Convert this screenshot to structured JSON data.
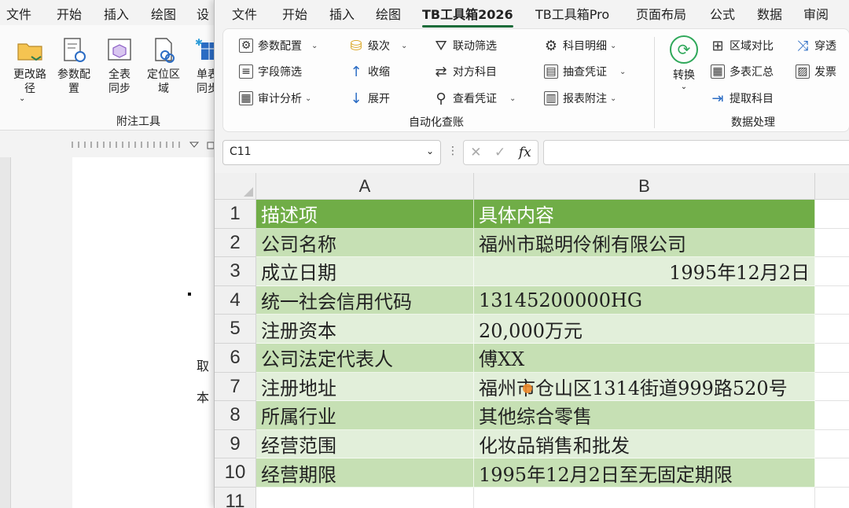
{
  "word": {
    "menu": [
      "文件",
      "开始",
      "插入",
      "绘图",
      "设"
    ],
    "ribbon_buttons": [
      {
        "label": "更改路\n径",
        "caret": "⌄"
      },
      {
        "label": "参数配\n置",
        "caret": "⌄"
      },
      {
        "label": "全表\n同步",
        "caret": ""
      },
      {
        "label": "定位区\n域",
        "caret": "⌄"
      },
      {
        "label": "单表\n同步",
        "caret": ""
      }
    ],
    "group_label": "附注工具",
    "page_text": [
      "取",
      "本"
    ]
  },
  "excel": {
    "tabs": [
      "文件",
      "开始",
      "插入",
      "绘图",
      "TB工具箱2026",
      "TB工具箱Pro",
      "页面布局",
      "公式",
      "数据",
      "审阅"
    ],
    "active_tab": "TB工具箱2026",
    "ribbon": {
      "col1": [
        "参数配置",
        "字段筛选",
        "审计分析"
      ],
      "col2": [
        "级次",
        "收缩",
        "展开"
      ],
      "col3": [
        "联动筛选",
        "对方科目",
        "查看凭证"
      ],
      "col4": [
        "科目明细",
        "抽查凭证",
        "报表附注"
      ],
      "group1_label": "自动化查账",
      "convert": "转换",
      "col5": [
        "区域对比",
        "多表汇总",
        "提取科目"
      ],
      "col6": [
        "穿透",
        "发票"
      ],
      "group2_label": "数据处理"
    },
    "formula_bar": {
      "name_box": "C11",
      "formula": ""
    },
    "columns": [
      "A",
      "B"
    ],
    "rows": [
      {
        "num": "1",
        "a": "描述项",
        "b": "具体内容"
      },
      {
        "num": "2",
        "a": "公司名称",
        "b": "福州市聪明伶俐有限公司"
      },
      {
        "num": "3",
        "a": "成立日期",
        "b": "1995年12月2日"
      },
      {
        "num": "4",
        "a": "统一社会信用代码",
        "b": "13145200000HG"
      },
      {
        "num": "5",
        "a": "注册资本",
        "b": "20,000万元"
      },
      {
        "num": "6",
        "a": "公司法定代表人",
        "b": "傅XX"
      },
      {
        "num": "7",
        "a": "注册地址",
        "b": "福州市仓山区1314街道999路520号"
      },
      {
        "num": "8",
        "a": "所属行业",
        "b": "其他综合零售"
      },
      {
        "num": "9",
        "a": "经营范围",
        "b": "化妆品销售和批发"
      },
      {
        "num": "10",
        "a": "经营期限",
        "b": "1995年12月2日至无固定期限"
      },
      {
        "num": "11",
        "a": "",
        "b": ""
      }
    ],
    "colors": {
      "header_fill": "#70ad47",
      "band_dark": "#c6e0b4",
      "band_light": "#e2efda",
      "accent": "#1b6b39"
    }
  }
}
